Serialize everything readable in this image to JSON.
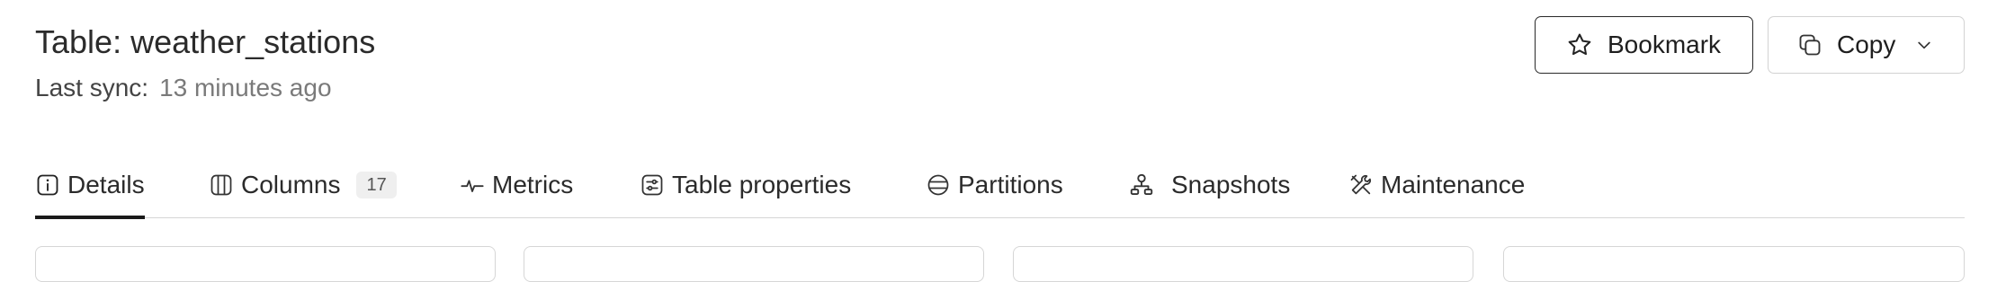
{
  "header": {
    "title": "Table: weather_stations",
    "sync_label": "Last sync:",
    "sync_value": "13 minutes ago"
  },
  "actions": {
    "bookmark_label": "Bookmark",
    "copy_label": "Copy"
  },
  "tabs": [
    {
      "label": "Details",
      "icon": "info-icon",
      "active": true
    },
    {
      "label": "Columns",
      "icon": "columns-icon",
      "badge": "17"
    },
    {
      "label": "Metrics",
      "icon": "pulse-icon"
    },
    {
      "label": "Table properties",
      "icon": "properties-icon"
    },
    {
      "label": "Partitions",
      "icon": "partitions-icon"
    },
    {
      "label": "Snapshots",
      "icon": "snapshots-icon"
    },
    {
      "label": "Maintenance",
      "icon": "tools-icon"
    }
  ],
  "colors": {
    "active_underline": "#1a1a1a",
    "border": "#d6d6d6",
    "muted_text": "#7a7a7a"
  }
}
